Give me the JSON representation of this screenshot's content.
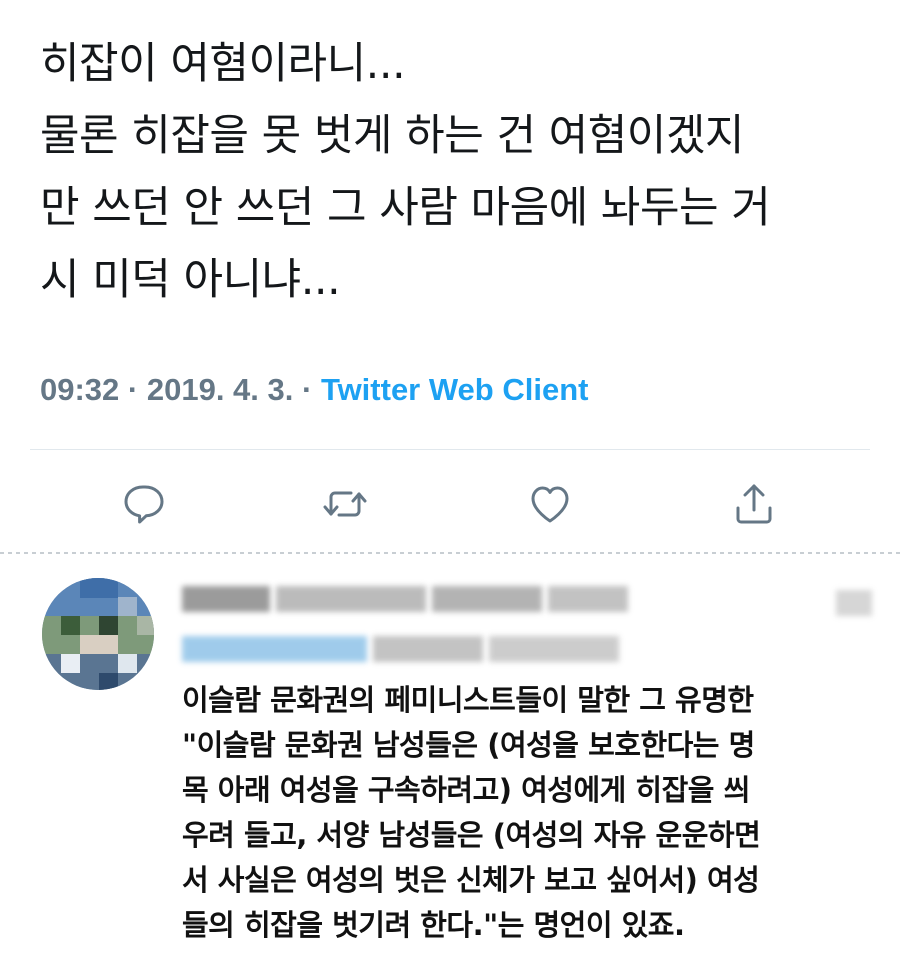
{
  "tweet": {
    "lines": [
      "히잡이 여혐이라니...",
      "물론 히잡을 못 벗게 하는 건 여혐이겠지",
      "만 쓰던 안 쓰던 그 사람 마음에 놔두는 거",
      "시 미덕 아니냐..."
    ],
    "time": "09:32",
    "date": "2019. 4. 3.",
    "source": "Twitter Web Client",
    "separator": " · "
  },
  "actions": [
    {
      "name": "reply",
      "icon": "reply-icon"
    },
    {
      "name": "retweet",
      "icon": "retweet-icon"
    },
    {
      "name": "like",
      "icon": "heart-icon"
    },
    {
      "name": "share",
      "icon": "share-icon"
    }
  ],
  "reply": {
    "lines": [
      "이슬람 문화권의 페미니스트들이 말한 그 유명한",
      "\"이슬람 문화권 남성들은 (여성을 보호한다는 명",
      "목 아래 여성을 구속하려고) 여성에게 히잡을 씌",
      "우려 들고, 서양 남성들은 (여성의 자유 운운하면",
      "서 사실은 여성의 벗은 신체가 보고 싶어서) 여성",
      "들의 히잡을 벗기려 한다.\"는 명언이 있죠."
    ]
  },
  "colors": {
    "text": "#14171a",
    "meta": "#657786",
    "link": "#1da1f2",
    "icon": "#657786",
    "divider": "#e1e8ed"
  }
}
